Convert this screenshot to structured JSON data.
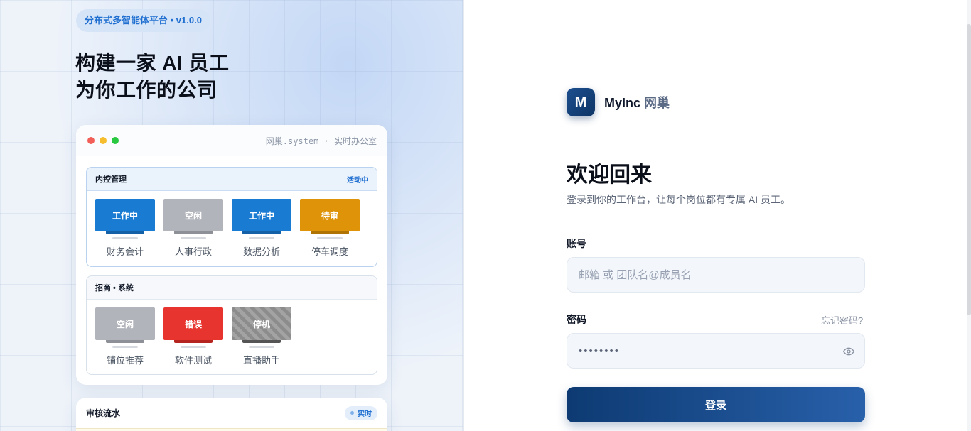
{
  "hero": {
    "badge": "分布式多智能体平台 • v1.0.0",
    "headline_line1": "构建一家 AI 员工",
    "headline_line2": "为你工作的公司"
  },
  "office_window": {
    "title": "网巢.system · 实时办公室",
    "groups": [
      {
        "title": "内控管理",
        "status": "活动中",
        "stations": [
          {
            "state": "工作中",
            "role": "财务会计"
          },
          {
            "state": "空闲",
            "role": "人事行政"
          },
          {
            "state": "工作中",
            "role": "数据分析"
          },
          {
            "state": "待审",
            "role": "停车调度"
          }
        ]
      },
      {
        "title": "招商 • 系统",
        "status": "",
        "stations": [
          {
            "state": "空闲",
            "role": "铺位推荐"
          },
          {
            "state": "错误",
            "role": "软件测试"
          },
          {
            "state": "停机",
            "role": "直播助手"
          }
        ]
      }
    ]
  },
  "audit_card": {
    "title": "审核流水",
    "live_label": "实时"
  },
  "brand": {
    "logo_letter": "M",
    "name": "MyInc",
    "sub": "网巢"
  },
  "login": {
    "title": "欢迎回来",
    "subtitle": "登录到你的工作台，让每个岗位都有专属 AI 员工。",
    "account_label": "账号",
    "account_placeholder": "邮箱 或 团队名@成员名",
    "password_label": "密码",
    "forgot_label": "忘记密码?",
    "password_value": "••••••••",
    "submit_label": "登录"
  },
  "colors": {
    "working": "#1a7bd3",
    "idle": "#b1b4bb",
    "pending": "#de9309",
    "error": "#e8342e",
    "offline": "#8c8c8c",
    "primary_button": "#1a4b8c"
  },
  "icons": {
    "password_toggle": "eye-icon"
  }
}
